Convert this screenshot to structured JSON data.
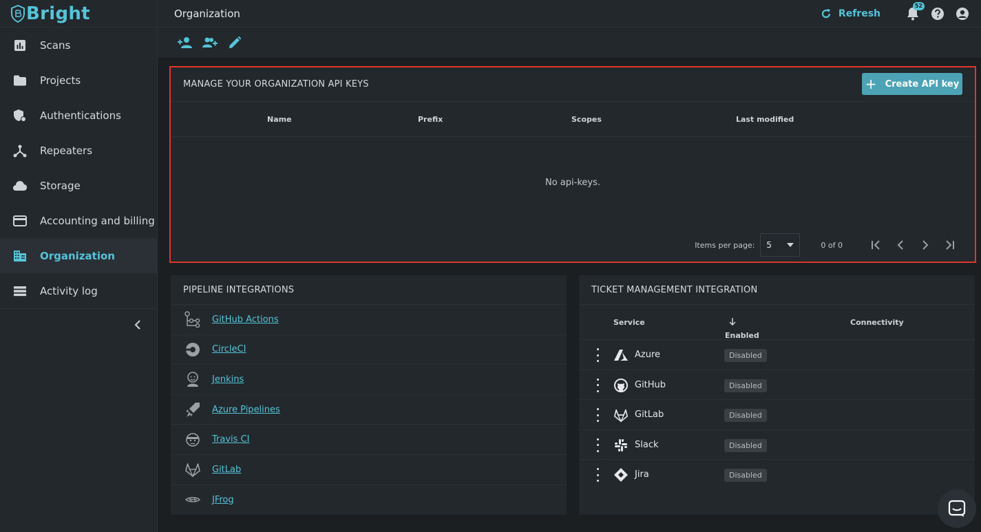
{
  "brand": {
    "name": "Bright",
    "color": "#55c3d8"
  },
  "sidebar": {
    "items": [
      {
        "label": "Scans",
        "icon": "bar-chart-icon"
      },
      {
        "label": "Projects",
        "icon": "folder-icon"
      },
      {
        "label": "Authentications",
        "icon": "shield-lock-icon"
      },
      {
        "label": "Repeaters",
        "icon": "repeater-icon"
      },
      {
        "label": "Storage",
        "icon": "cloud-icon"
      },
      {
        "label": "Accounting and billing",
        "icon": "credit-card-icon"
      },
      {
        "label": "Organization",
        "icon": "building-icon",
        "active": true
      },
      {
        "label": "Activity log",
        "icon": "list-icon"
      }
    ]
  },
  "header": {
    "title": "Organization",
    "refresh_label": "Refresh",
    "notifications_count": "52"
  },
  "api_keys": {
    "title": "MANAGE YOUR ORGANIZATION API KEYS",
    "create_label": "Create API key",
    "columns": [
      "Name",
      "Prefix",
      "Scopes",
      "Last modified"
    ],
    "empty_text": "No api-keys.",
    "items_per_page_label": "Items per page:",
    "items_per_page_value": "5",
    "range_label": "0 of 0"
  },
  "pipelines": {
    "title": "PIPELINE INTEGRATIONS",
    "items": [
      {
        "label": "GitHub Actions",
        "icon": "github-actions-icon"
      },
      {
        "label": "CircleCI",
        "icon": "circleci-icon"
      },
      {
        "label": "Jenkins",
        "icon": "jenkins-icon"
      },
      {
        "label": "Azure Pipelines",
        "icon": "azure-pipelines-icon"
      },
      {
        "label": "Travis CI",
        "icon": "travis-ci-icon"
      },
      {
        "label": "GitLab",
        "icon": "gitlab-icon"
      },
      {
        "label": "JFrog",
        "icon": "jfrog-icon"
      }
    ]
  },
  "tickets": {
    "title": "TICKET MANAGEMENT INTEGRATION",
    "columns": {
      "service": "Service",
      "enabled": "Enabled",
      "connectivity": "Connectivity"
    },
    "rows": [
      {
        "service": "Azure",
        "status": "Disabled",
        "icon": "azure-icon"
      },
      {
        "service": "GitHub",
        "status": "Disabled",
        "icon": "github-icon"
      },
      {
        "service": "GitLab",
        "status": "Disabled",
        "icon": "gitlab-icon"
      },
      {
        "service": "Slack",
        "status": "Disabled",
        "icon": "slack-icon"
      },
      {
        "service": "Jira",
        "status": "Disabled",
        "icon": "jira-icon"
      }
    ]
  },
  "colors": {
    "accent": "#55c3d8",
    "highlight_outline": "#e0352b",
    "button": "#4ca3b6"
  }
}
